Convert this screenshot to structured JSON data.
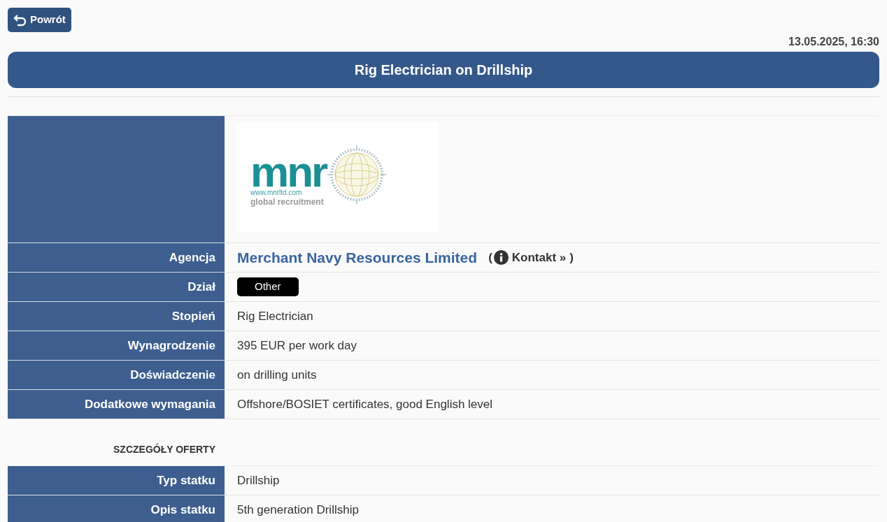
{
  "back_button": {
    "label": "Powrót"
  },
  "timestamp": "13.05.2025, 16:30",
  "title": "Rig Electrician on Drillship",
  "logo": {
    "wordmark": "mnr",
    "url": "www.mnrltd.com",
    "tagline": "global recruitment"
  },
  "details": [
    {
      "kind": "agency",
      "label": "Agencja",
      "value": "Merchant Navy Resources Limited",
      "contact": {
        "open": "(",
        "label": "Kontakt »",
        "close": ")"
      }
    },
    {
      "kind": "badge",
      "label": "Dział",
      "value": "Other"
    },
    {
      "kind": "text",
      "label": "Stopień",
      "value": "Rig Electrician"
    },
    {
      "kind": "text",
      "label": "Wynagrodzenie",
      "value": "395 EUR per work day"
    },
    {
      "kind": "text",
      "label": "Doświadczenie",
      "value": "on drilling units"
    },
    {
      "kind": "text",
      "label": "Dodatkowe wymagania",
      "value": "Offshore/BOSIET certificates, good English level"
    }
  ],
  "offer_section": {
    "heading": "SZCZEGÓŁY OFERTY",
    "rows": [
      {
        "label": "Typ statku",
        "value": "Drillship"
      },
      {
        "label": "Opis statku",
        "value": "5th generation Drillship"
      }
    ]
  }
}
